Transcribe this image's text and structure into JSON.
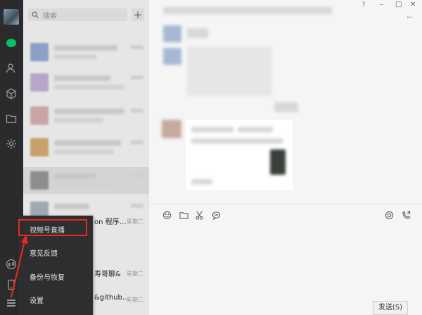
{
  "search": {
    "placeholder": "搜索"
  },
  "add_label": "+",
  "popup_menu": {
    "items": [
      {
        "label": "视频号直播"
      },
      {
        "label": "意见反馈"
      },
      {
        "label": "备份与恢复"
      },
      {
        "label": "设置"
      }
    ]
  },
  "chat_list": {
    "partial_rows": [
      {
        "text": "on 程序…",
        "time": "星期二"
      },
      {
        "text": "寿哥聊&",
        "time": "星期二"
      },
      {
        "text": "&github…",
        "time": "星期二"
      }
    ]
  },
  "window_controls": {
    "pin": "⫯",
    "minimize": "–",
    "maximize": "□",
    "close": "✕"
  },
  "more_label": "···",
  "send_button": {
    "label": "发送(S)"
  },
  "colors": {
    "nav_bg": "#2b2b2d",
    "chat_active": "#07c160",
    "highlight": "#e02b20"
  }
}
